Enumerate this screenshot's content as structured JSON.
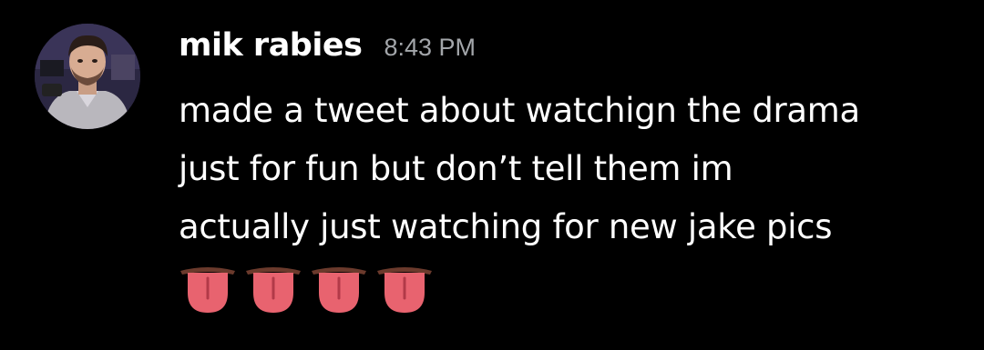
{
  "message": {
    "author": {
      "name": "mik rabies",
      "color": "#ffffff",
      "avatar": "profile-photo"
    },
    "timestamp": "8:43 PM",
    "lines": [
      "made a tweet about watchign the drama",
      "just for fun but don’t tell them im",
      "actually just watching for new jake pics"
    ],
    "emojis": [
      "tongue",
      "tongue",
      "tongue",
      "tongue"
    ]
  },
  "colors": {
    "background": "#000000",
    "text": "#ffffff",
    "timestamp": "#a3a6aa",
    "emoji_tongue": "#e8636f"
  }
}
